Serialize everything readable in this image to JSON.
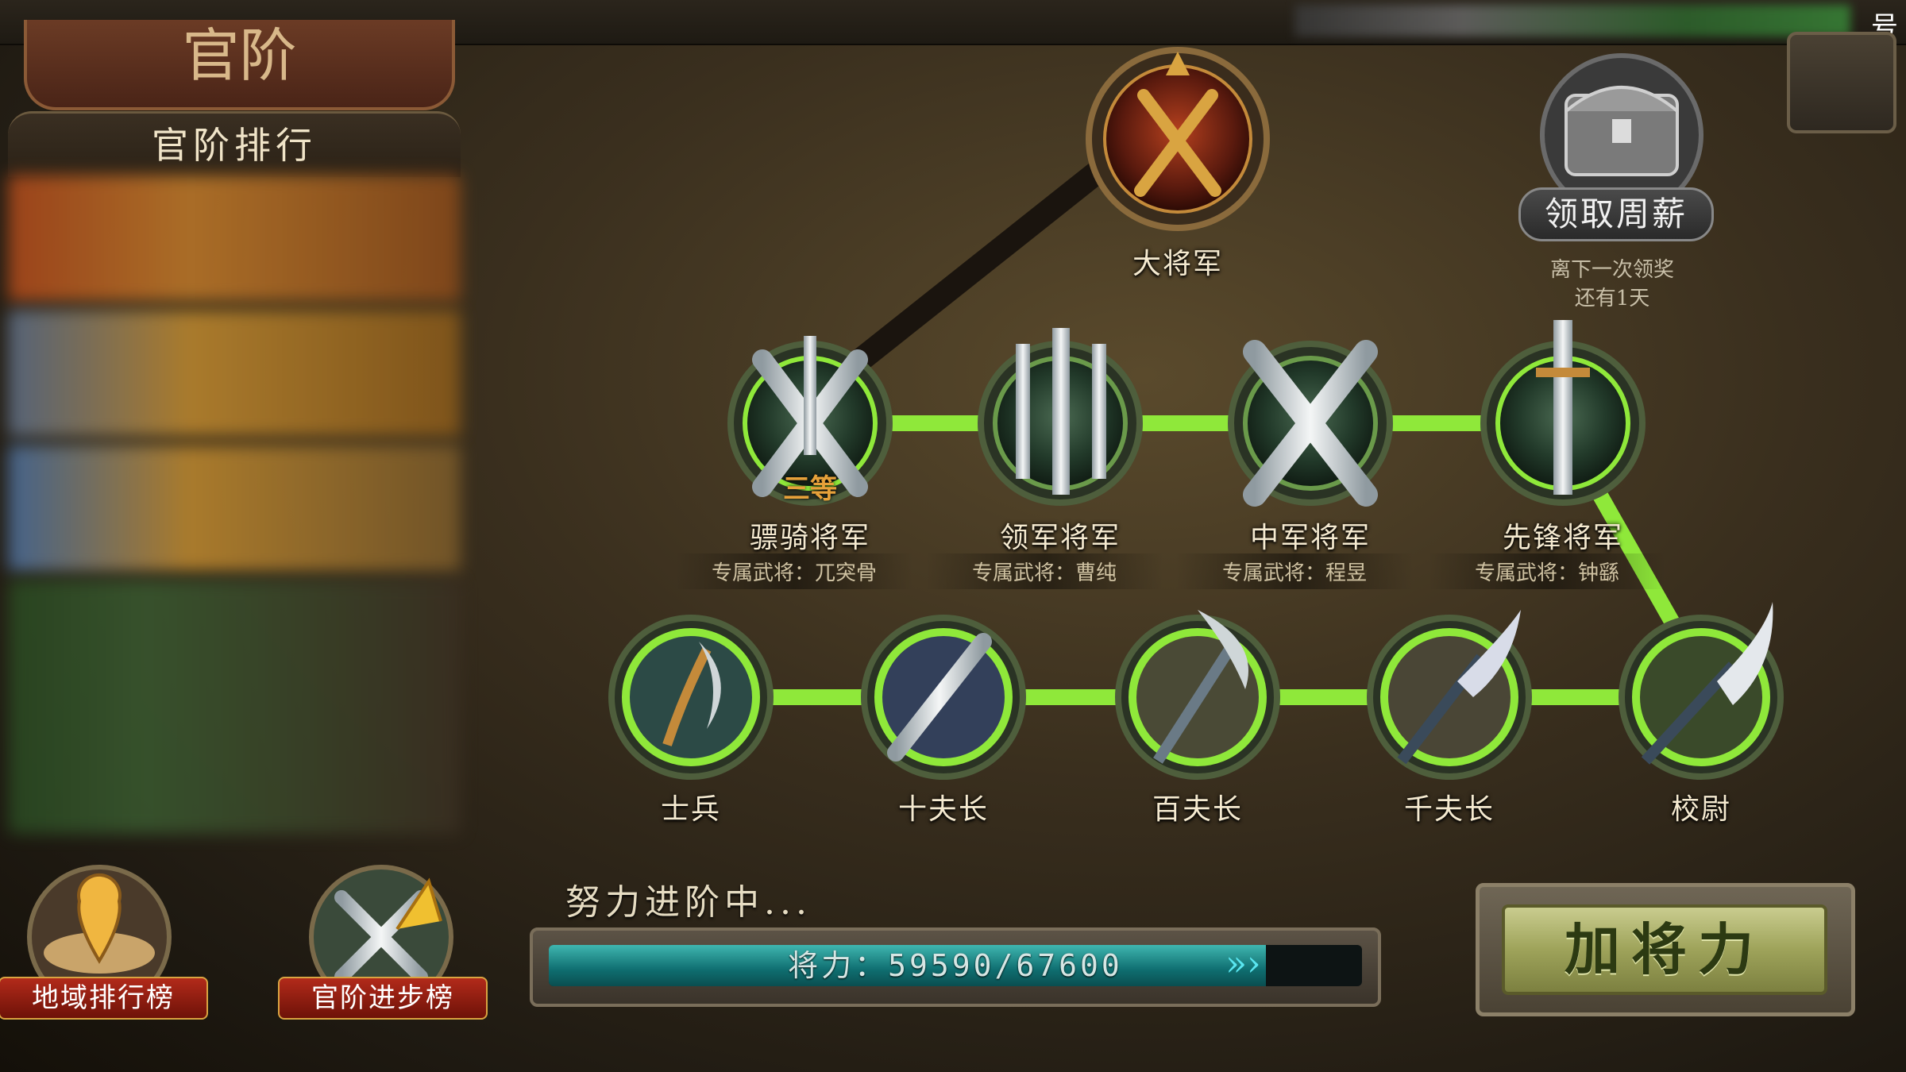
{
  "header": {
    "title": "官阶",
    "right_tag": "号"
  },
  "ranking": {
    "header": "官阶排行"
  },
  "ranks": {
    "top": {
      "name": "大将军"
    },
    "upper": [
      {
        "name": "骠骑将军",
        "hero": "专属武将：兀突骨",
        "badge": "三等"
      },
      {
        "name": "领军将军",
        "hero": "专属武将：曹纯"
      },
      {
        "name": "中军将军",
        "hero": "专属武将：程昱"
      },
      {
        "name": "先锋将军",
        "hero": "专属武将：钟繇"
      }
    ],
    "lower": [
      {
        "name": "士兵"
      },
      {
        "name": "十夫长"
      },
      {
        "name": "百夫长"
      },
      {
        "name": "千夫长"
      },
      {
        "name": "校尉"
      }
    ]
  },
  "weekly_pay": {
    "label": "领取周薪",
    "note_line1": "离下一次领奖",
    "note_line2": "还有1天"
  },
  "bottom_buttons": {
    "region_rank": "地域排行榜",
    "rank_progress": "官阶进步榜"
  },
  "progress": {
    "caption": "努力进阶中...",
    "text": "将力：59590/67600",
    "current": 59590,
    "max": 67600
  },
  "main_button": {
    "label": "加将力"
  },
  "colors": {
    "path_active": "#8fe83a",
    "accent_green": "#2f8a2a"
  }
}
